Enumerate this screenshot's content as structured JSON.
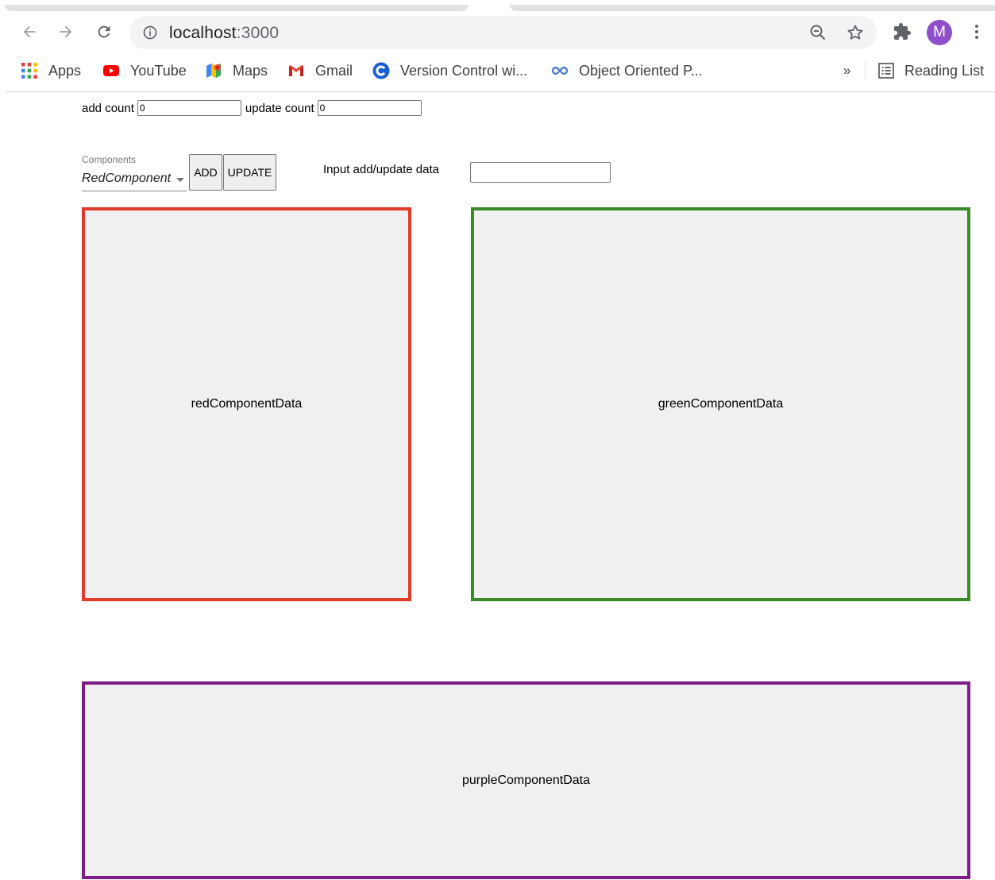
{
  "browser": {
    "url_host": "localhost",
    "url_port": ":3000",
    "avatar_initial": "M",
    "bookmarks": [
      {
        "label": "Apps",
        "icon": "apps-grid-icon"
      },
      {
        "label": "YouTube",
        "icon": "youtube-icon"
      },
      {
        "label": "Maps",
        "icon": "maps-icon"
      },
      {
        "label": "Gmail",
        "icon": "gmail-icon"
      },
      {
        "label": "Version Control wi...",
        "icon": "c-logo-icon"
      },
      {
        "label": "Object Oriented P...",
        "icon": "infinity-logo-icon"
      }
    ],
    "overflow_label": "»",
    "reading_list_label": "Reading List"
  },
  "counts": {
    "add_label": "add count",
    "add_value": "0",
    "update_label": "update count",
    "update_value": "0"
  },
  "controls": {
    "select_label": "Components",
    "select_value": "RedComponent",
    "add_button": "ADD",
    "update_button": "UPDATE",
    "input_label": "Input add/update data",
    "input_value": ""
  },
  "components": {
    "red": {
      "text": "redComponentData",
      "border_color": "#e23b2a"
    },
    "green": {
      "text": "greenComponentData",
      "border_color": "#3a8a2a"
    },
    "purple": {
      "text": "purpleComponentData",
      "border_color": "#7c1d85"
    }
  }
}
